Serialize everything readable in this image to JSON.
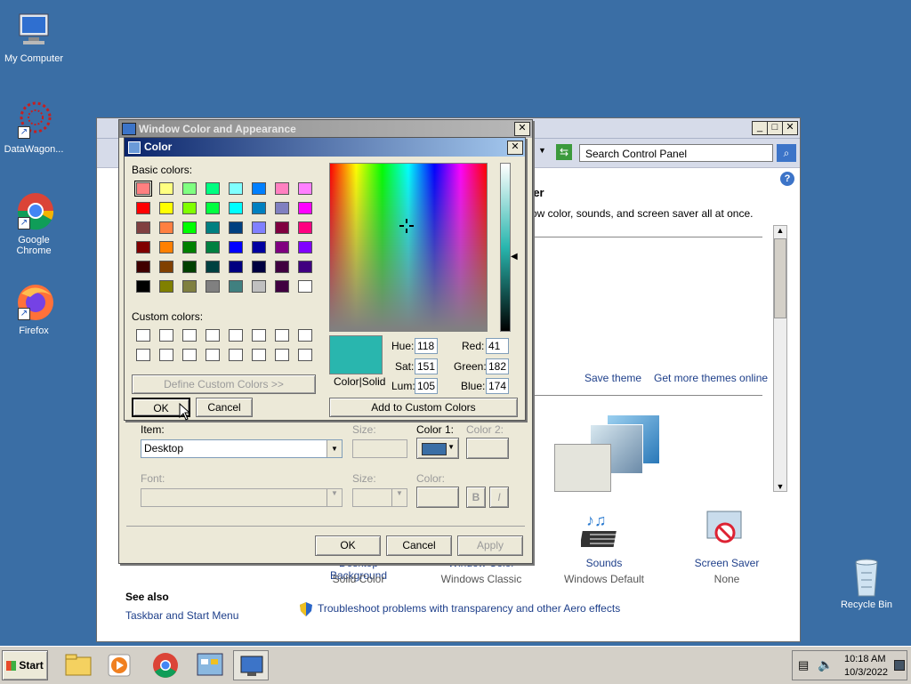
{
  "desktop": {
    "icons": [
      {
        "label": "My Computer"
      },
      {
        "label": "DataWagon..."
      },
      {
        "label": "Google Chrome"
      },
      {
        "label": "Firefox"
      },
      {
        "label": "Recycle Bin"
      }
    ]
  },
  "control_panel": {
    "search_placeholder": "Search Control Panel",
    "heading_fragment": "ter",
    "subtitle_fragment": "ow color, sounds, and screen saver all at once.",
    "save_theme": "Save theme",
    "more_themes": "Get more themes online",
    "items": [
      {
        "label": "Desktop Background",
        "value": "Solid Color"
      },
      {
        "label": "Window Color",
        "value": "Windows Classic"
      },
      {
        "label": "Sounds",
        "value": "Windows Default"
      },
      {
        "label": "Screen Saver",
        "value": "None"
      }
    ],
    "see_also": "See also",
    "taskbar_link": "Taskbar and Start Menu",
    "troubleshoot_link": "Troubleshoot problems with transparency and other Aero effects"
  },
  "appearance_dialog": {
    "title": "Window Color and Appearance",
    "item_label": "Item:",
    "item_value": "Desktop",
    "size_label": "Size:",
    "color1_label": "Color 1:",
    "color2_label": "Color 2:",
    "color1_value": "#3a6ea5",
    "font_label": "Font:",
    "font_size_label": "Size:",
    "font_color_label": "Color:",
    "bold_label": "B",
    "italic_label": "I",
    "ok": "OK",
    "cancel": "Cancel",
    "apply": "Apply"
  },
  "color_dialog": {
    "title": "Color",
    "basic_colors_label": "Basic colors:",
    "custom_colors_label": "Custom colors:",
    "define_custom": "Define Custom Colors >>",
    "ok": "OK",
    "cancel": "Cancel",
    "add_custom": "Add to Custom Colors",
    "color_solid_label": "Color|Solid",
    "preview_color": "#29b6ae",
    "hue_label": "Hue:",
    "hue": "118",
    "sat_label": "Sat:",
    "sat": "151",
    "lum_label": "Lum:",
    "lum": "105",
    "red_label": "Red:",
    "red": "41",
    "green_label": "Green:",
    "green": "182",
    "blue_label": "Blue:",
    "blue": "174",
    "basic_colors": [
      "#ff8080",
      "#ffff80",
      "#80ff80",
      "#00ff80",
      "#80ffff",
      "#0080ff",
      "#ff80c0",
      "#ff80ff",
      "#ff0000",
      "#ffff00",
      "#80ff00",
      "#00ff40",
      "#00ffff",
      "#0080c0",
      "#8080c0",
      "#ff00ff",
      "#804040",
      "#ff8040",
      "#00ff00",
      "#008080",
      "#004080",
      "#8080ff",
      "#800040",
      "#ff0080",
      "#800000",
      "#ff8000",
      "#008000",
      "#008040",
      "#0000ff",
      "#0000a0",
      "#800080",
      "#8000ff",
      "#400000",
      "#804000",
      "#004000",
      "#004040",
      "#000080",
      "#000040",
      "#400040",
      "#400080",
      "#000000",
      "#808000",
      "#808040",
      "#808080",
      "#408080",
      "#c0c0c0",
      "#400040",
      "#ffffff"
    ]
  },
  "taskbar": {
    "start": "Start",
    "time": "10:18 AM",
    "date": "10/3/2022"
  }
}
